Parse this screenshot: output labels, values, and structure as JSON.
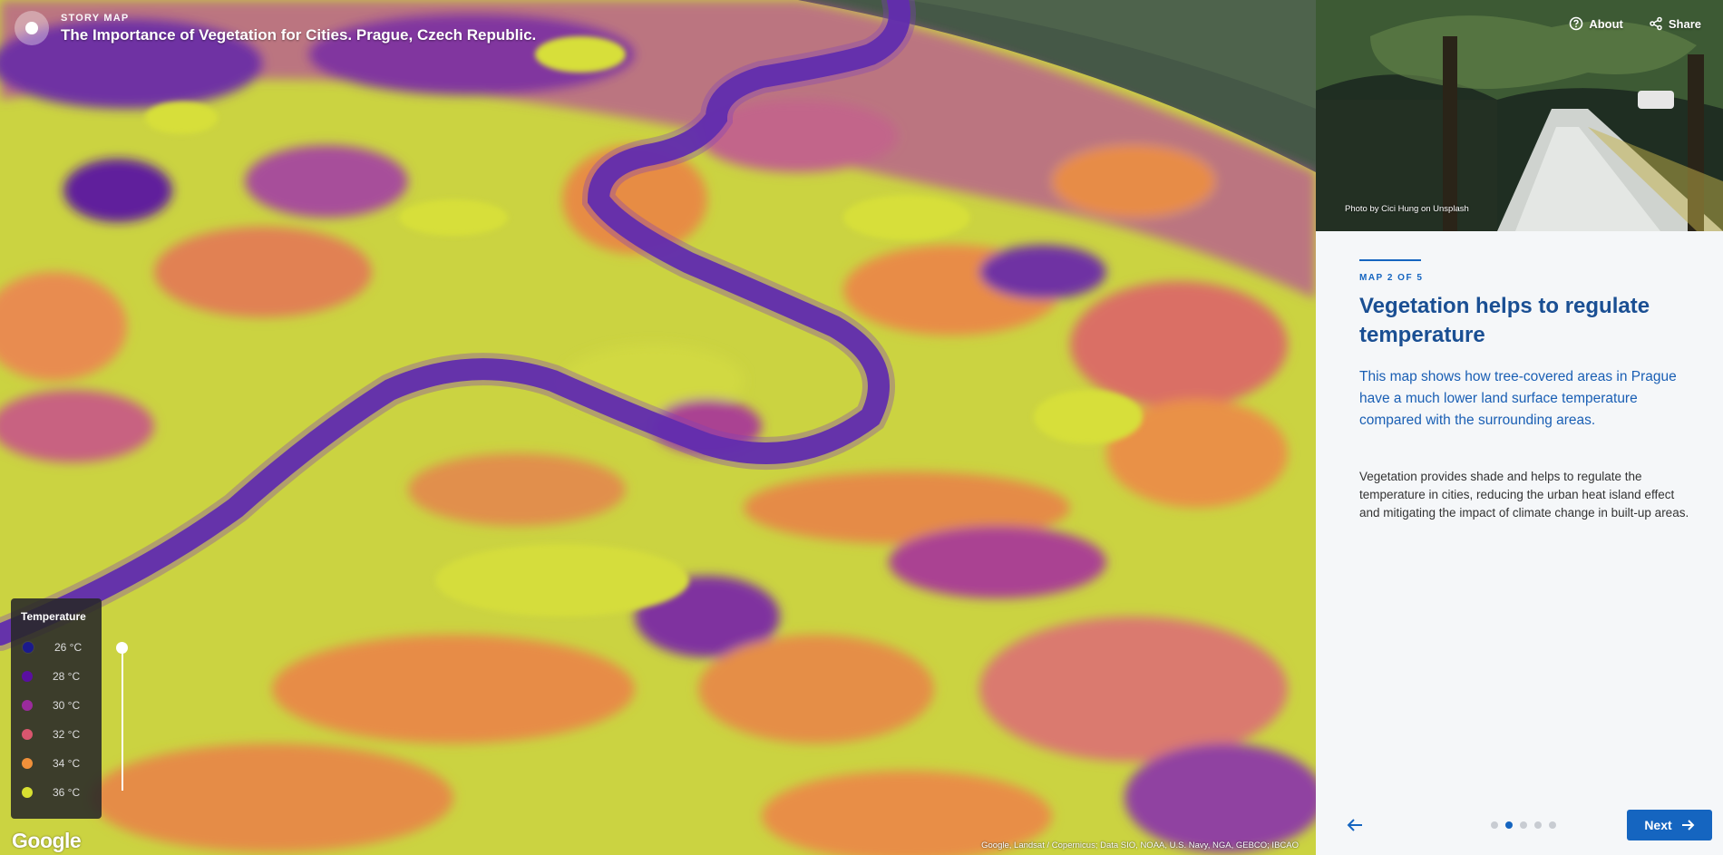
{
  "header": {
    "eyebrow": "STORY MAP",
    "title": "The Importance of Vegetation for Cities. Prague, Czech Republic."
  },
  "legend": {
    "title": "Temperature",
    "items": [
      {
        "label": "26 °C",
        "color": "#1b1a8c"
      },
      {
        "label": "28 °C",
        "color": "#5a0fa0"
      },
      {
        "label": "30 °C",
        "color": "#9b2b9c"
      },
      {
        "label": "32 °C",
        "color": "#d9566e"
      },
      {
        "label": "34 °C",
        "color": "#f0903a"
      },
      {
        "label": "36 °C",
        "color": "#d8e031"
      }
    ]
  },
  "map": {
    "logo": "Google",
    "attribution": "Google, Landsat / Copernicus; Data SIO, NOAA, U.S. Navy, NGA, GEBCO; IBCAO"
  },
  "panel": {
    "actions": {
      "about": "About",
      "share": "Share"
    },
    "photo_credit": "Photo by Cici Hung on Unsplash",
    "map_counter": "MAP 2 OF 5",
    "heading": "Vegetation helps to regulate temperature",
    "lead": "This map shows how tree-covered areas in Prague have a much lower land surface temperature compared with the surrounding areas.",
    "body": "Vegetation provides shade and helps to regulate the temperature in cities, reducing the urban heat island effect and mitigating the impact of climate change in built-up areas.",
    "next_label": "Next",
    "total_pages": 5,
    "current_page": 2
  },
  "colors": {
    "accent": "#1565c0",
    "heading": "#1a4f93"
  }
}
